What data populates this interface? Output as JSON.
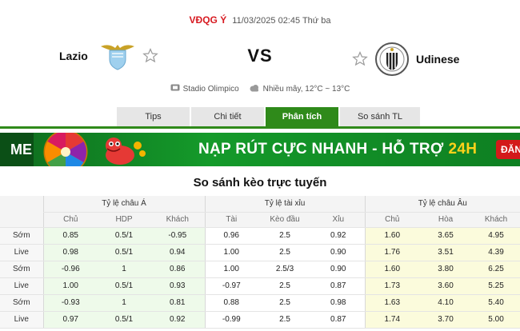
{
  "match": {
    "league": "VĐQG Ý",
    "datetime": "11/03/2025 02:45 Thứ ba",
    "home_team": "Lazio",
    "away_team": "Udinese",
    "vs": "VS",
    "venue": "Stadio Olimpico",
    "weather": "Nhiều mây, 12°C ~ 13°C"
  },
  "tabs": [
    {
      "label": "Tips",
      "active": false
    },
    {
      "label": "Chi tiết",
      "active": false
    },
    {
      "label": "Phân tích",
      "active": true
    },
    {
      "label": "So sánh TL",
      "active": false
    }
  ],
  "banner": {
    "left_text": "ME",
    "text_main": "NẠP RÚT CỰC NHANH - HỖ TRỢ",
    "text_highlight": "24H",
    "button": "ĐĂN"
  },
  "odds": {
    "title": "So sánh kèo trực tuyến",
    "groups": [
      "Tỷ lệ châu Á",
      "Tỷ lệ tài xỉu",
      "Tỷ lệ châu Âu"
    ],
    "subheaders": [
      "Chủ",
      "HDP",
      "Khách",
      "Tài",
      "Kèo đầu",
      "Xỉu",
      "Chủ",
      "Hòa",
      "Khách"
    ],
    "rows": [
      {
        "label": "Sớm",
        "cells": [
          "0.85",
          "0.5/1",
          "-0.95",
          "0.96",
          "2.5",
          "0.92",
          "1.60",
          "3.65",
          "4.95"
        ]
      },
      {
        "label": "Live",
        "cells": [
          "0.98",
          "0.5/1",
          "0.94",
          "1.00",
          "2.5",
          "0.90",
          "1.76",
          "3.51",
          "4.39"
        ]
      },
      {
        "label": "Sớm",
        "cells": [
          "-0.96",
          "1",
          "0.86",
          "1.00",
          "2.5/3",
          "0.90",
          "1.60",
          "3.80",
          "6.25"
        ]
      },
      {
        "label": "Live",
        "cells": [
          "1.00",
          "0.5/1",
          "0.93",
          "-0.97",
          "2.5",
          "0.87",
          "1.73",
          "3.60",
          "5.25"
        ]
      },
      {
        "label": "Sớm",
        "cells": [
          "-0.93",
          "1",
          "0.81",
          "0.88",
          "2.5",
          "0.98",
          "1.63",
          "4.10",
          "5.40"
        ]
      },
      {
        "label": "Live",
        "cells": [
          "0.97",
          "0.5/1",
          "0.92",
          "-0.99",
          "2.5",
          "0.87",
          "1.74",
          "3.70",
          "5.00"
        ]
      }
    ]
  },
  "colors": {
    "accent_green": "#2f8a1a",
    "league_red": "#d71920"
  }
}
